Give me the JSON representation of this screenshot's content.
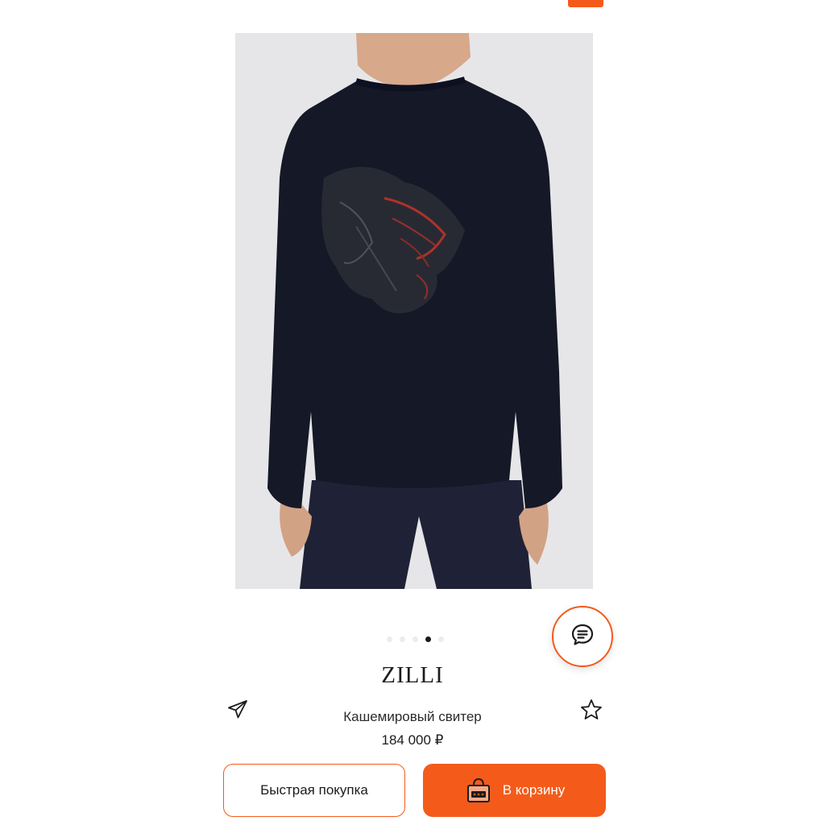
{
  "product": {
    "brand": "ZILLI",
    "name": "Кашемировый свитер",
    "price": "184 000 ₽",
    "image_alt": "sweater-back-view"
  },
  "gallery": {
    "total_images": 5,
    "active_index": 3
  },
  "actions": {
    "quick_buy_label": "Быстрая покупка",
    "add_to_cart_label": "В корзину"
  },
  "icons": {
    "share": "send-icon",
    "favorite": "star-icon",
    "chat": "chat-icon",
    "cart": "shopping-bag-icon"
  },
  "colors": {
    "accent": "#f45b1b",
    "text": "#1c1c1c",
    "image_bg": "#e5e5e7"
  }
}
